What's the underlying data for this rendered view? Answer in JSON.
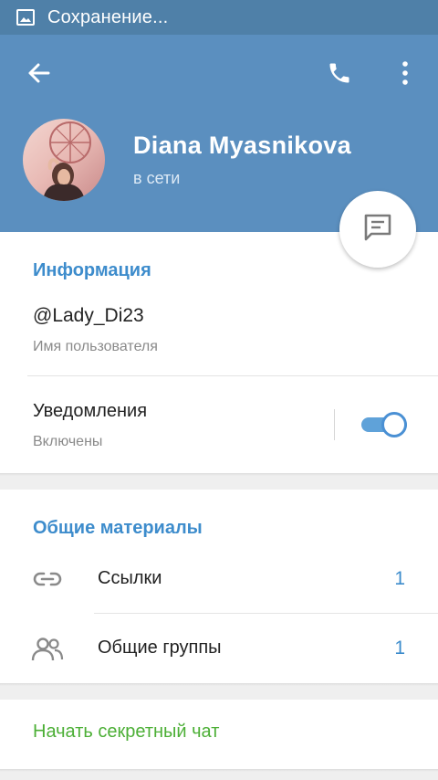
{
  "status_bar": {
    "text": "Сохранение...",
    "icon": "image-icon"
  },
  "header": {
    "back_icon": "arrow-back-icon",
    "call_icon": "phone-icon",
    "more_icon": "more-vert-icon",
    "name": "Diana Myasnikova",
    "status": "в сети",
    "avatar": "avatar-photo",
    "fab_icon": "message-icon"
  },
  "info": {
    "title": "Информация",
    "username": "@Lady_Di23",
    "username_caption": "Имя пользователя",
    "notifications_label": "Уведомления",
    "notifications_state": "Включены",
    "notifications_on": true
  },
  "shared": {
    "title": "Общие материалы",
    "items": [
      {
        "icon": "link-icon",
        "label": "Ссылки",
        "count": "1"
      },
      {
        "icon": "group-icon",
        "label": "Общие группы",
        "count": "1"
      }
    ]
  },
  "secret_chat": {
    "label": "Начать секретный чат"
  },
  "colors": {
    "header": "#5b8fbf",
    "status_bar": "#4f80a8",
    "accent_blue": "#3d8ccc",
    "secret_green": "#4caf36",
    "toggle": "#5fa2d9"
  }
}
